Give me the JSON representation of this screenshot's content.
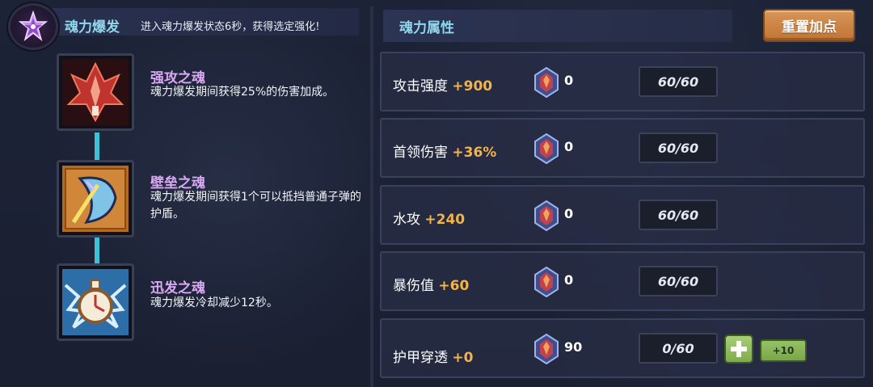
{
  "soul_burst": {
    "title": "魂力爆发",
    "description": "进入魂力爆发状态6秒，获得选定强化!"
  },
  "souls": [
    {
      "name": "强攻之魂",
      "description": "魂力爆发期间获得25%的伤害加成。",
      "icon": "red-soul-icon"
    },
    {
      "name": "壁垒之魂",
      "description": "魂力爆发期间获得1个可以抵挡普通子弹的护盾。",
      "icon": "shield-soul-icon"
    },
    {
      "name": "迅发之魂",
      "description": "魂力爆发冷却减少12秒。",
      "icon": "clock-soul-icon"
    }
  ],
  "attributes": {
    "title": "魂力属性",
    "reset_label": "重置加点",
    "rows": [
      {
        "name": "攻击强度",
        "bonus": "+900",
        "gems": "0",
        "level": "60/60"
      },
      {
        "name": "首领伤害",
        "bonus": "+36%",
        "gems": "0",
        "level": "60/60"
      },
      {
        "name": "水攻",
        "bonus": "+240",
        "gems": "0",
        "level": "60/60"
      },
      {
        "name": "暴伤值",
        "bonus": "+60",
        "gems": "0",
        "level": "60/60"
      },
      {
        "name": "护甲穿透",
        "bonus": "+0",
        "gems": "90",
        "level": "0/60",
        "plus_ten_label": "+10"
      }
    ]
  },
  "colors": {
    "soul_name": "#d9a8f3",
    "header_text": "#8fd7ec",
    "bonus": "#f2b34a",
    "reset_button": "#c07434",
    "plus_button": "#7eac4c"
  }
}
